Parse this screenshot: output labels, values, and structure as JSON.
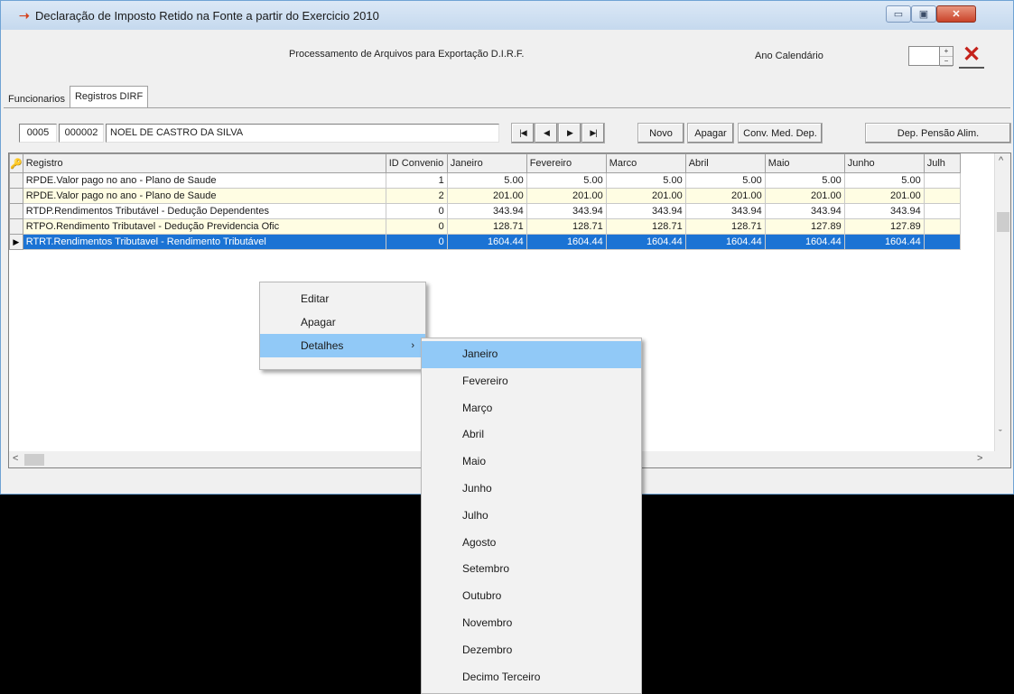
{
  "window": {
    "title": "Declaração de Imposto Retido na Fonte a partir do Exercicio 2010",
    "min_glyph": "▭",
    "max_glyph": "▣",
    "close_glyph": "✕"
  },
  "header": {
    "processing_label": "Processamento de Arquivos para Exportação D.I.R.F.",
    "ano_label": "Ano Calendário",
    "ano_value": "",
    "spin_up": "+",
    "spin_down": "−",
    "cancel_glyph": "✕"
  },
  "tabs": [
    {
      "label": "Funcionarios",
      "active": false
    },
    {
      "label": "Registros DIRF",
      "active": true
    }
  ],
  "record": {
    "code1": "0005",
    "code2": "000002",
    "employee": "NOEL DE CASTRO DA SILVA"
  },
  "toolbar": {
    "first": "|◀",
    "prev": "◀",
    "next": "▶",
    "last": "▶|",
    "novo": "Novo",
    "apagar": "Apagar",
    "conv": "Conv. Med. Dep.",
    "pensao": "Dep. Pensão Alim."
  },
  "grid": {
    "columns": [
      "Registro",
      "ID Convenio",
      "Janeiro",
      "Fevereiro",
      "Marco",
      "Abril",
      "Maio",
      "Junho",
      "Julh"
    ],
    "rows": [
      {
        "cells": [
          "RPDE.Valor pago no ano - Plano de Saude",
          "1",
          "5.00",
          "5.00",
          "5.00",
          "5.00",
          "5.00",
          "5.00",
          ""
        ]
      },
      {
        "cells": [
          "RPDE.Valor pago no ano - Plano de Saude",
          "2",
          "201.00",
          "201.00",
          "201.00",
          "201.00",
          "201.00",
          "201.00",
          ""
        ]
      },
      {
        "cells": [
          "RTDP.Rendimentos Tributável - Dedução Dependentes",
          "0",
          "343.94",
          "343.94",
          "343.94",
          "343.94",
          "343.94",
          "343.94",
          ""
        ]
      },
      {
        "cells": [
          "RTPO.Rendimento Tributavel - Dedução Previdencia Ofic",
          "0",
          "128.71",
          "128.71",
          "128.71",
          "128.71",
          "127.89",
          "127.89",
          ""
        ]
      },
      {
        "cells": [
          "RTRT.Rendimentos Tributavel - Rendimento Tributável",
          "0",
          "1604.44",
          "1604.44",
          "1604.44",
          "1604.44",
          "1604.44",
          "1604.44",
          ""
        ]
      }
    ],
    "current_row_marker": "▶",
    "key_glyph": "🔑"
  },
  "context_menu": {
    "items": [
      "Editar",
      "Apagar",
      "Detalhes"
    ],
    "submenu_arrow": "›"
  },
  "submenu": {
    "items": [
      "Janeiro",
      "Fevereiro",
      "Março",
      "Abril",
      "Maio",
      "Junho",
      "Julho",
      "Agosto",
      "Setembro",
      "Outubro",
      "Novembro",
      "Dezembro",
      "Decimo Terceiro"
    ]
  }
}
